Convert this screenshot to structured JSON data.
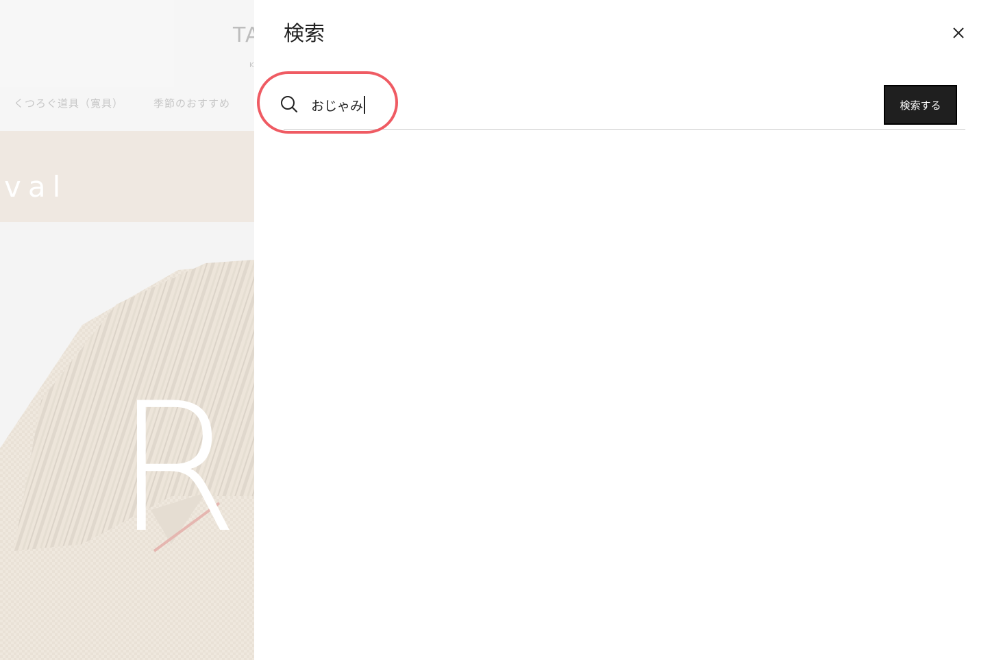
{
  "background_page": {
    "logo": "TA",
    "logo_sub": "K",
    "nav_items": [
      "くつろぐ道具（寛具）",
      "季節のおすすめ"
    ],
    "banner_text": "val",
    "hero_letter": "R"
  },
  "search": {
    "title": "検索",
    "query": "おじゃみ",
    "submit_label": "検索する",
    "icon": "search-icon",
    "close_icon": "close-icon"
  },
  "colors": {
    "highlight": "#ef5b63",
    "button_bg": "#1f1f1f"
  }
}
